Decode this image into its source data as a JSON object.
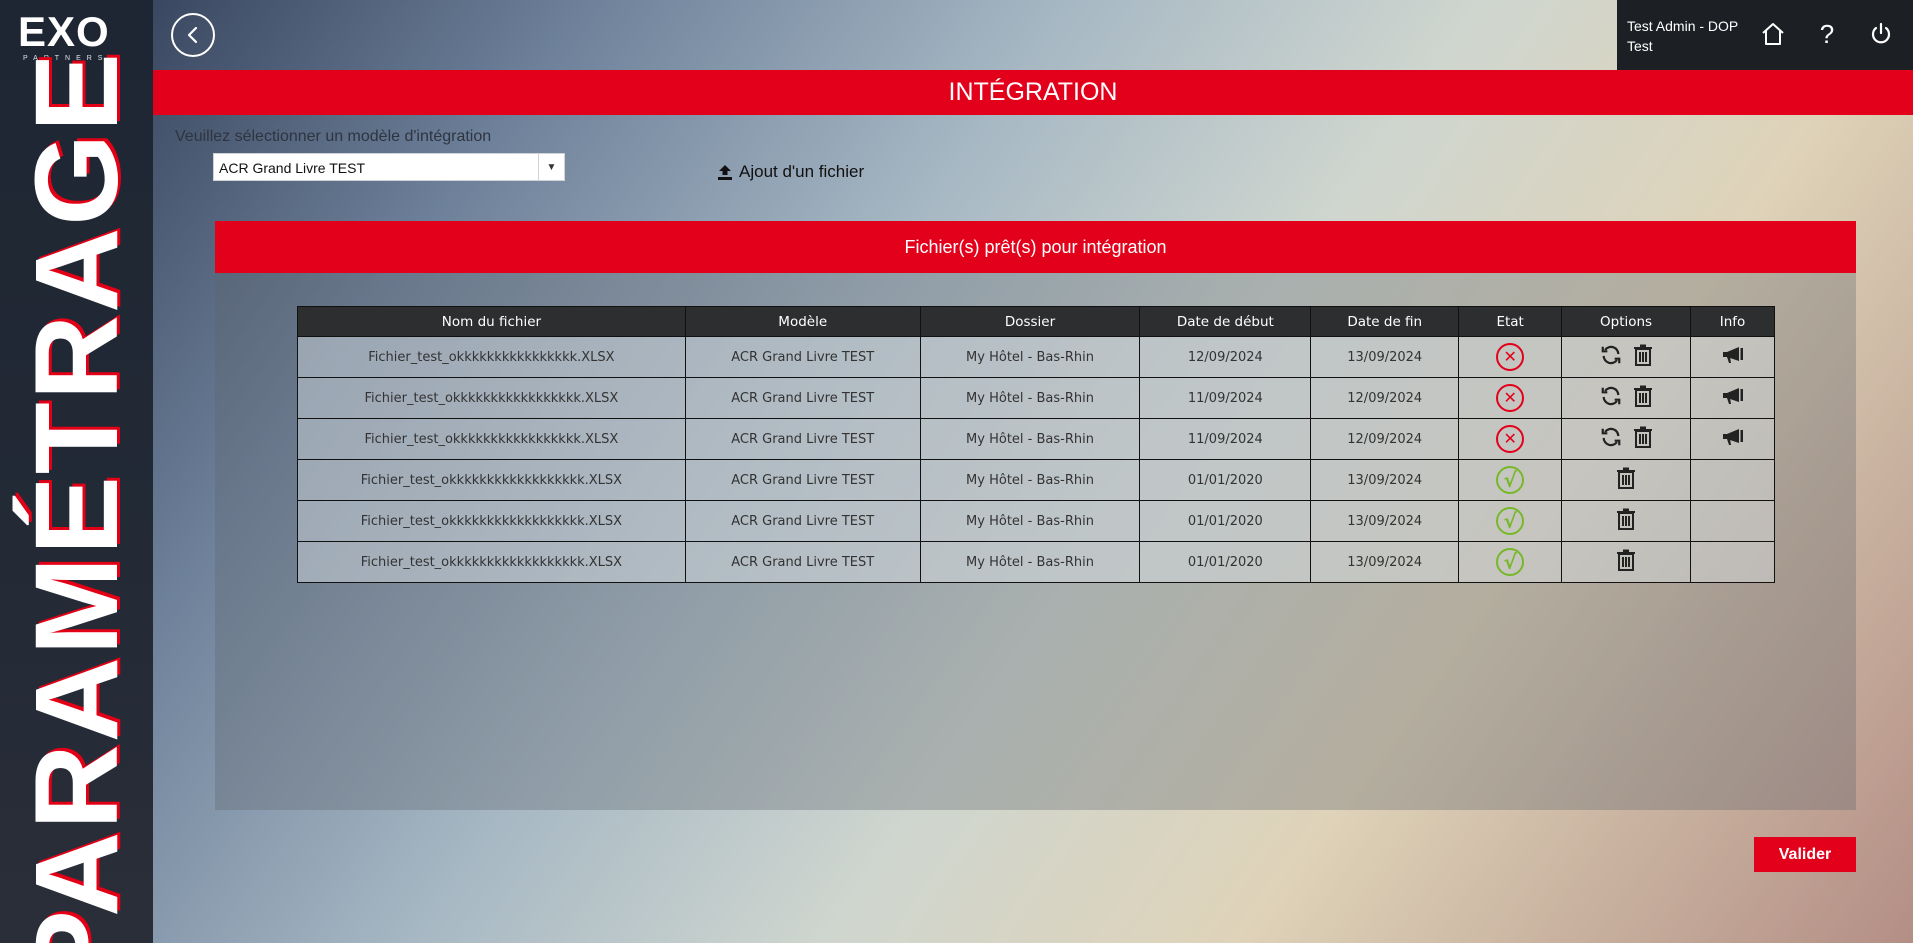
{
  "brand": {
    "logo_text": "EXO",
    "logo_sub": "PARTNERS"
  },
  "sidebar": {
    "vertical_title": "PARAMÉTRAGE"
  },
  "header": {
    "user": "Test Admin - DOP Test"
  },
  "page": {
    "title": "INTÉGRATION"
  },
  "selector": {
    "label": "Veuillez sélectionner un modèle d'intégration",
    "value": "ACR Grand Livre TEST",
    "upload_label": "Ajout d'un fichier"
  },
  "panel": {
    "title": "Fichier(s) prêt(s) pour intégration"
  },
  "table": {
    "headers": [
      "Nom du fichier",
      "Modèle",
      "Dossier",
      "Date de début",
      "Date de fin",
      "Etat",
      "Options",
      "Info"
    ],
    "rows": [
      {
        "file": "Fichier_test_okkkkkkkkkkkkkkkk.XLSX",
        "model": "ACR Grand Livre TEST",
        "folder": "My Hôtel - Bas-Rhin",
        "start": "12/09/2024",
        "end": "13/09/2024",
        "state": "error"
      },
      {
        "file": "Fichier_test_okkkkkkkkkkkkkkkkk.XLSX",
        "model": "ACR Grand Livre TEST",
        "folder": "My Hôtel - Bas-Rhin",
        "start": "11/09/2024",
        "end": "12/09/2024",
        "state": "error"
      },
      {
        "file": "Fichier_test_okkkkkkkkkkkkkkkkk.XLSX",
        "model": "ACR Grand Livre TEST",
        "folder": "My Hôtel - Bas-Rhin",
        "start": "11/09/2024",
        "end": "12/09/2024",
        "state": "error"
      },
      {
        "file": "Fichier_test_okkkkkkkkkkkkkkkkkk.XLSX",
        "model": "ACR Grand Livre TEST",
        "folder": "My Hôtel - Bas-Rhin",
        "start": "01/01/2020",
        "end": "13/09/2024",
        "state": "ok"
      },
      {
        "file": "Fichier_test_okkkkkkkkkkkkkkkkkk.XLSX",
        "model": "ACR Grand Livre TEST",
        "folder": "My Hôtel - Bas-Rhin",
        "start": "01/01/2020",
        "end": "13/09/2024",
        "state": "ok"
      },
      {
        "file": "Fichier_test_okkkkkkkkkkkkkkkkkk.XLSX",
        "model": "ACR Grand Livre TEST",
        "folder": "My Hôtel - Bas-Rhin",
        "start": "01/01/2020",
        "end": "13/09/2024",
        "state": "ok"
      }
    ]
  },
  "actions": {
    "validate": "Valider"
  },
  "colors": {
    "accent": "#e3001b",
    "ok": "#76b82a",
    "sidebar": "#1e2633"
  }
}
